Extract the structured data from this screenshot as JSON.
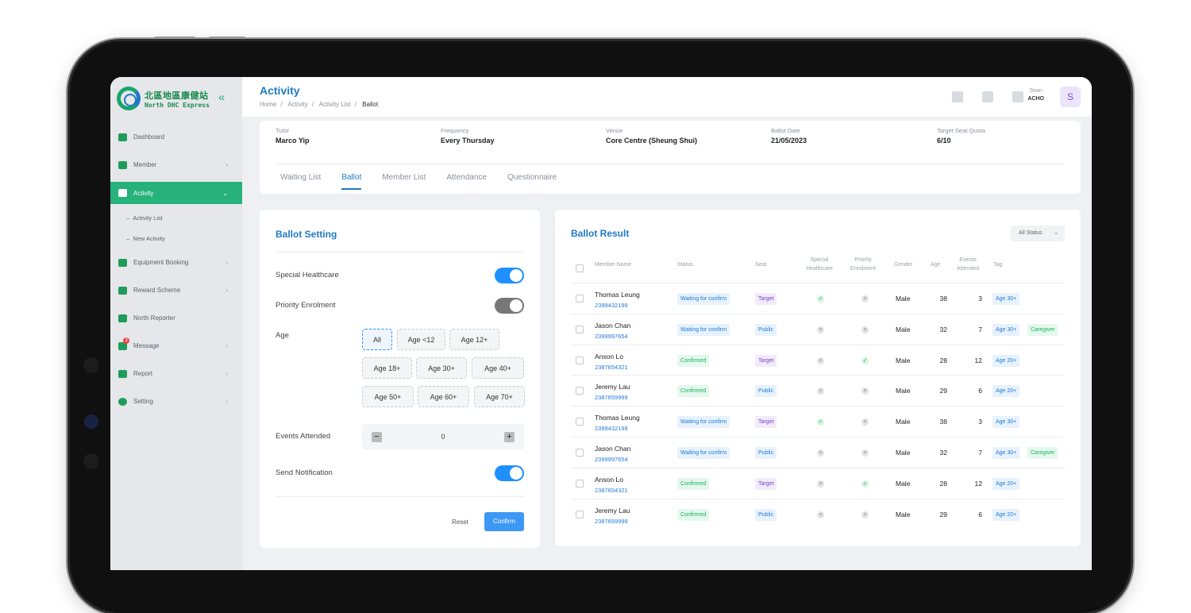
{
  "sidebar": {
    "logo_cn": "北區地區康健站",
    "logo_en": "North DHC Express",
    "items": [
      {
        "label": "Dashboard",
        "icon": "dashboard-icon"
      },
      {
        "label": "Member",
        "icon": "member-icon"
      },
      {
        "label": "Activity",
        "icon": "activity-icon",
        "active": true
      },
      {
        "label": "Equipment Booking",
        "icon": "equipment-icon"
      },
      {
        "label": "Reward Scheme",
        "icon": "gift-icon"
      },
      {
        "label": "North Reporter",
        "icon": "reporter-icon"
      },
      {
        "label": "Message",
        "icon": "message-icon",
        "badge": "3"
      },
      {
        "label": "Report",
        "icon": "report-icon"
      },
      {
        "label": "Setting",
        "icon": "gear-icon"
      }
    ],
    "activity_sub": [
      "Activity List",
      "New Activity"
    ]
  },
  "header": {
    "title": "Activity",
    "breadcrumb": [
      "Home",
      "Activity",
      "Activity List",
      "Ballot"
    ],
    "user_name": "Sean",
    "user_org": "ACHO",
    "avatar_letter": "S"
  },
  "info": [
    {
      "label": "Tutor",
      "value": "Marco Yip"
    },
    {
      "label": "Frequency",
      "value": "Every Thursday"
    },
    {
      "label": "Venue",
      "value": "Core Centre (Sheung Shui)"
    },
    {
      "label": "Ballot Date",
      "value": "21/05/2023"
    },
    {
      "label": "Target Seat Quota",
      "value": "6/10"
    }
  ],
  "tabs": [
    "Waiting List",
    "Ballot",
    "Member List",
    "Attendance",
    "Questionnaire"
  ],
  "ballot_setting": {
    "title": "Ballot Setting",
    "special_healthcare_label": "Special Healthcare",
    "priority_enrolment_label": "Priority Enrolment",
    "age_label": "Age",
    "age_options": [
      "All",
      "Age <12",
      "Age 12+",
      "Age 18+",
      "Age 30+",
      "Age 40+",
      "Age 50+",
      "Age 60+",
      "Age 70+"
    ],
    "events_attended_label": "Events Attended",
    "events_attended_value": "0",
    "send_notification_label": "Send Notification",
    "reset_label": "Reset",
    "confirm_label": "Confirm"
  },
  "ballot_result": {
    "title": "Ballot Result",
    "filter": "All Status",
    "columns": [
      "Member Name",
      "Status",
      "Seat",
      "Special Healthcare",
      "Priority Enrolment",
      "Gender",
      "Age",
      "Events Attended",
      "Tag"
    ],
    "rows": [
      {
        "name": "Thomas Leung",
        "id": "2399432199",
        "status": "Waiting for confirm",
        "seat": "Target",
        "special": true,
        "priority": false,
        "gender": "Male",
        "age": "38",
        "events": "3",
        "tags": [
          "Age 30+"
        ]
      },
      {
        "name": "Jason Chan",
        "id": "2399997654",
        "status": "Waiting for confirm",
        "seat": "Public",
        "special": false,
        "priority": false,
        "gender": "Male",
        "age": "32",
        "events": "7",
        "tags": [
          "Age 30+",
          "Caregiver"
        ]
      },
      {
        "name": "Anson Lo",
        "id": "2387654321",
        "status": "Confirmed",
        "seat": "Target",
        "special": false,
        "priority": true,
        "gender": "Male",
        "age": "28",
        "events": "12",
        "tags": [
          "Age 20+"
        ]
      },
      {
        "name": "Jeremy Lau",
        "id": "2387659999",
        "status": "Confirmed",
        "seat": "Public",
        "special": false,
        "priority": false,
        "gender": "Male",
        "age": "29",
        "events": "6",
        "tags": [
          "Age 20+"
        ]
      },
      {
        "name": "Thomas Leung",
        "id": "2399432199",
        "status": "Waiting for confirm",
        "seat": "Target",
        "special": true,
        "priority": false,
        "gender": "Male",
        "age": "38",
        "events": "3",
        "tags": [
          "Age 30+"
        ]
      },
      {
        "name": "Jason Chan",
        "id": "2399997654",
        "status": "Waiting for confirm",
        "seat": "Public",
        "special": false,
        "priority": false,
        "gender": "Male",
        "age": "32",
        "events": "7",
        "tags": [
          "Age 30+",
          "Caregiver"
        ]
      },
      {
        "name": "Anson Lo",
        "id": "2387654321",
        "status": "Confirmed",
        "seat": "Target",
        "special": false,
        "priority": true,
        "gender": "Male",
        "age": "28",
        "events": "12",
        "tags": [
          "Age 20+"
        ]
      },
      {
        "name": "Jeremy Lau",
        "id": "2387659999",
        "status": "Confirmed",
        "seat": "Public",
        "special": false,
        "priority": false,
        "gender": "Male",
        "age": "29",
        "events": "6",
        "tags": [
          "Age 20+"
        ]
      }
    ]
  }
}
